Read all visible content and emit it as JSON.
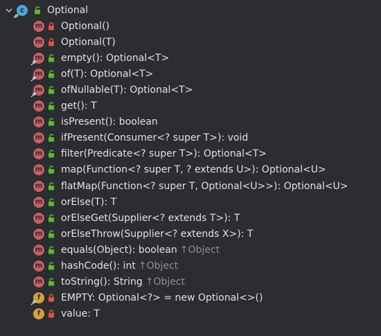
{
  "root": {
    "label": "Optional",
    "icon": "class-icon",
    "expanded": true
  },
  "members": [
    {
      "kind": "method",
      "visibility": "private",
      "static": false,
      "text": "Optional()",
      "inherited": ""
    },
    {
      "kind": "method",
      "visibility": "private",
      "static": false,
      "text": "Optional(T)",
      "inherited": ""
    },
    {
      "kind": "method",
      "visibility": "public",
      "static": true,
      "text": "empty(): Optional<T>",
      "inherited": ""
    },
    {
      "kind": "method",
      "visibility": "public",
      "static": true,
      "text": "of(T): Optional<T>",
      "inherited": ""
    },
    {
      "kind": "method",
      "visibility": "public",
      "static": true,
      "text": "ofNullable(T): Optional<T>",
      "inherited": ""
    },
    {
      "kind": "method",
      "visibility": "public",
      "static": false,
      "text": "get(): T",
      "inherited": ""
    },
    {
      "kind": "method",
      "visibility": "public",
      "static": false,
      "text": "isPresent(): boolean",
      "inherited": ""
    },
    {
      "kind": "method",
      "visibility": "public",
      "static": false,
      "text": "ifPresent(Consumer<? super T>): void",
      "inherited": ""
    },
    {
      "kind": "method",
      "visibility": "public",
      "static": false,
      "text": "filter(Predicate<? super T>): Optional<T>",
      "inherited": ""
    },
    {
      "kind": "method",
      "visibility": "public",
      "static": false,
      "text": "map(Function<? super T, ? extends U>): Optional<U>",
      "inherited": ""
    },
    {
      "kind": "method",
      "visibility": "public",
      "static": false,
      "text": "flatMap(Function<? super T, Optional<U>>): Optional<U>",
      "inherited": ""
    },
    {
      "kind": "method",
      "visibility": "public",
      "static": false,
      "text": "orElse(T): T",
      "inherited": ""
    },
    {
      "kind": "method",
      "visibility": "public",
      "static": false,
      "text": "orElseGet(Supplier<? extends T>): T",
      "inherited": ""
    },
    {
      "kind": "method",
      "visibility": "public",
      "static": false,
      "text": "orElseThrow(Supplier<? extends X>): T",
      "inherited": ""
    },
    {
      "kind": "method",
      "visibility": "public",
      "static": false,
      "text": "equals(Object): boolean",
      "inherited": "Object"
    },
    {
      "kind": "method",
      "visibility": "public",
      "static": false,
      "text": "hashCode(): int",
      "inherited": "Object"
    },
    {
      "kind": "method",
      "visibility": "public",
      "static": false,
      "text": "toString(): String",
      "inherited": "Object"
    },
    {
      "kind": "field",
      "visibility": "private",
      "static": true,
      "text": "EMPTY: Optional<?> = new Optional<>()",
      "inherited": ""
    },
    {
      "kind": "field",
      "visibility": "private",
      "static": false,
      "text": "value: T",
      "inherited": ""
    }
  ],
  "glyphs": {
    "method": "m",
    "field": "f",
    "class": "c",
    "inherited_arrow": "↑"
  },
  "colors": {
    "background": "#2b2d30",
    "text": "#dfe1e5",
    "method_icon": "#c85b67",
    "field_icon": "#d8a13a",
    "class_icon": "#4aa8d8",
    "public_lock": "#5fb832",
    "private_lock": "#e0553a",
    "inherited_text": "#8b8e94"
  }
}
